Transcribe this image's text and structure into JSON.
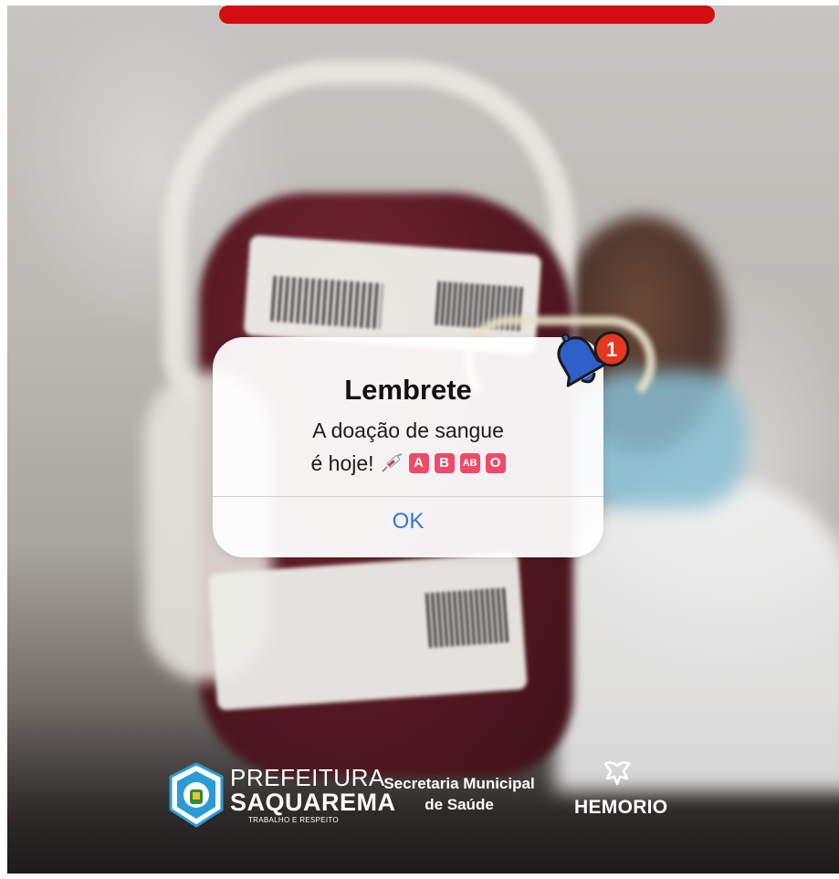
{
  "alert": {
    "title": "Lembrete",
    "message_line1": "A doação de sangue",
    "message_line2": "é hoje!",
    "blood_types": [
      "A",
      "B",
      "AB",
      "O"
    ],
    "ok_label": "OK",
    "notification_count": "1"
  },
  "footer": {
    "prefeitura_line1": "PREFEITURA",
    "prefeitura_line2": "SAQUAREMA",
    "prefeitura_tagline": "TRABALHO E RESPEITO",
    "secretaria_line1": "Secretaria Municipal",
    "secretaria_line2": "de Saúde",
    "hemorio": "HEMORIO"
  },
  "colors": {
    "top_bar": "#d40d12",
    "ok_text": "#2b79d4",
    "blood_badge": "#f04a6a",
    "bell": "#2f5fc8",
    "notification_badge": "#e53620"
  },
  "icons": [
    "syringe-icon",
    "bell-icon",
    "crest-icon",
    "hemorio-icon"
  ]
}
